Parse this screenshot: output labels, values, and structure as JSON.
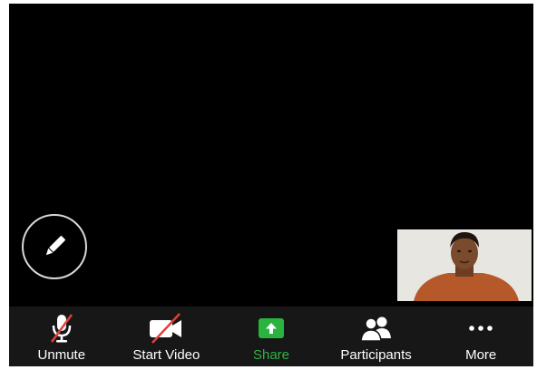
{
  "toolbar": {
    "items": [
      {
        "label": "Unmute",
        "icon": "microphone-muted-icon"
      },
      {
        "label": "Start Video",
        "icon": "video-camera-off-icon"
      },
      {
        "label": "Share",
        "icon": "share-arrow-up-icon",
        "color": "#2fb344"
      },
      {
        "label": "Participants",
        "icon": "participants-icon"
      },
      {
        "label": "More",
        "icon": "more-dots-icon"
      }
    ]
  },
  "annotate_button": {
    "icon": "pencil-icon"
  },
  "self_view": {
    "icon": "participant-video-thumbnail"
  }
}
